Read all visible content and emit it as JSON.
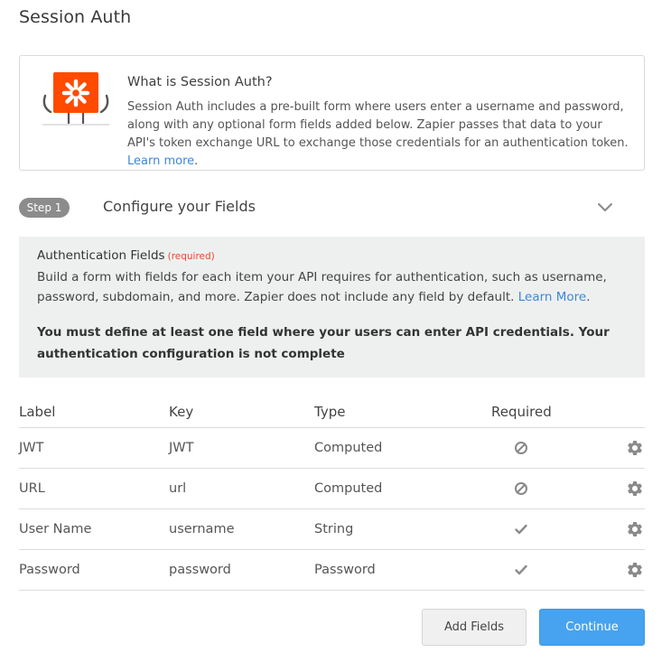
{
  "page": {
    "title": "Session Auth"
  },
  "info": {
    "heading": "What is Session Auth?",
    "description": "Session Auth includes a pre-built form where users enter a username and password, along with any optional form fields added below. Zapier passes that data to your API's token exchange URL to exchange those credentials for an authentication token.",
    "link": "Learn more",
    "link_suffix": "."
  },
  "step": {
    "badge": "Step 1",
    "title": "Configure your Fields"
  },
  "auth_fields": {
    "title": "Authentication Fields",
    "required_tag": "(required)",
    "body": "Build a form with fields for each item your API requires for authentication, such as username, password, subdomain, and more. Zapier does not include any field by default.",
    "link": "Learn More",
    "link_suffix": ".",
    "warning": "You must define at least one field where your users can enter API credentials. Your authentication configuration is not complete"
  },
  "table": {
    "headers": {
      "label": "Label",
      "key": "Key",
      "type": "Type",
      "required": "Required"
    },
    "rows": [
      {
        "label": "JWT",
        "key": "JWT",
        "type": "Computed",
        "required_icon": "not-allowed-icon"
      },
      {
        "label": "URL",
        "key": "url",
        "type": "Computed",
        "required_icon": "not-allowed-icon"
      },
      {
        "label": "User Name",
        "key": "username",
        "type": "String",
        "required_icon": "check-icon"
      },
      {
        "label": "Password",
        "key": "password",
        "type": "Password",
        "required_icon": "check-icon"
      }
    ]
  },
  "buttons": {
    "add_fields": "Add Fields",
    "continue": "Continue"
  },
  "colors": {
    "brand_orange": "#ff4a00",
    "link_blue": "#3d87d8",
    "primary_button": "#47a3ef",
    "required_red": "#e8492c",
    "badge_gray": "#8c8c8c"
  }
}
